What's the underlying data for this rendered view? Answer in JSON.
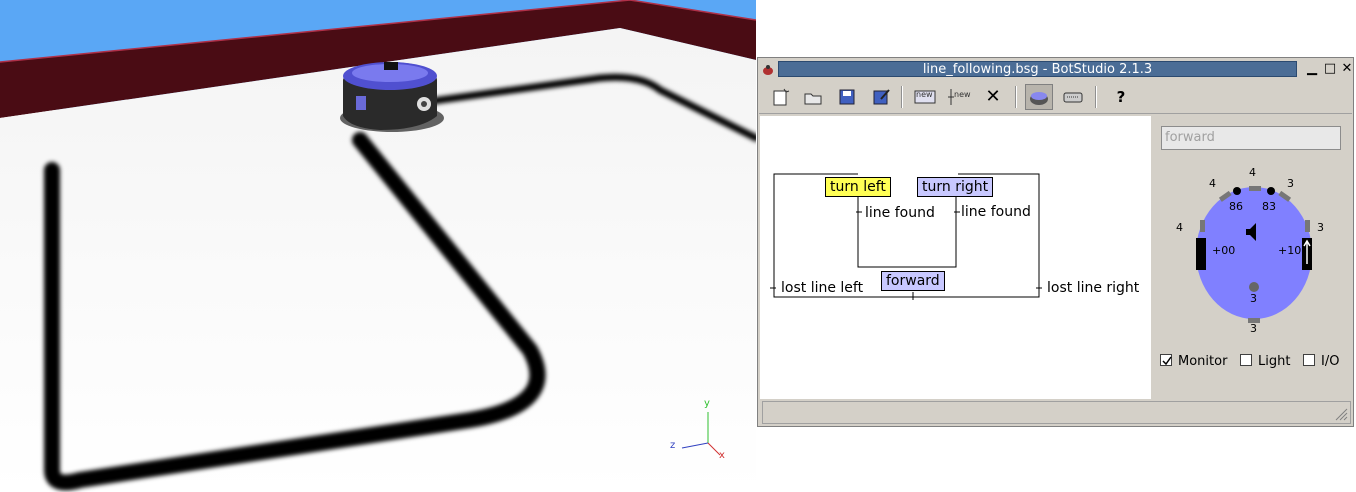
{
  "window": {
    "title": "line_following.bsg - BotStudio 2.1.3",
    "minimize_label": "▁",
    "maximize_label": "□",
    "close_label": "✕"
  },
  "toolbar": {
    "new_label": "new",
    "new2_label": "new",
    "delete_label": "✕",
    "help_label": "?"
  },
  "diagram": {
    "states": [
      {
        "label": "turn left",
        "color": "#ffff55"
      },
      {
        "label": "turn right",
        "color": "#c8c8ff"
      },
      {
        "label": "forward",
        "color": "#c8c8ff"
      }
    ],
    "transitions": [
      "line found",
      "line found",
      "lost line left",
      "lost line right"
    ]
  },
  "robot_panel": {
    "command_placeholder": "forward",
    "body_color": "#8080ff",
    "sensor_values": {
      "top": "4",
      "top_left": "4",
      "top_right": "3",
      "ground_left": "86",
      "ground_right": "83",
      "left": "4",
      "right": "3",
      "motor_left": "+00",
      "motor_right": "+10",
      "center": "3",
      "bottom": "3"
    },
    "checkboxes": [
      {
        "label": "Monitor",
        "checked": true
      },
      {
        "label": "Light",
        "checked": false
      },
      {
        "label": "I/O",
        "checked": false
      }
    ]
  },
  "scene": {
    "axes": {
      "y": "y",
      "z": "z",
      "x": "x"
    },
    "sky_color": "#5aa7f5",
    "wall_color": "#4a0c14",
    "floor_color": "#ffffff"
  }
}
